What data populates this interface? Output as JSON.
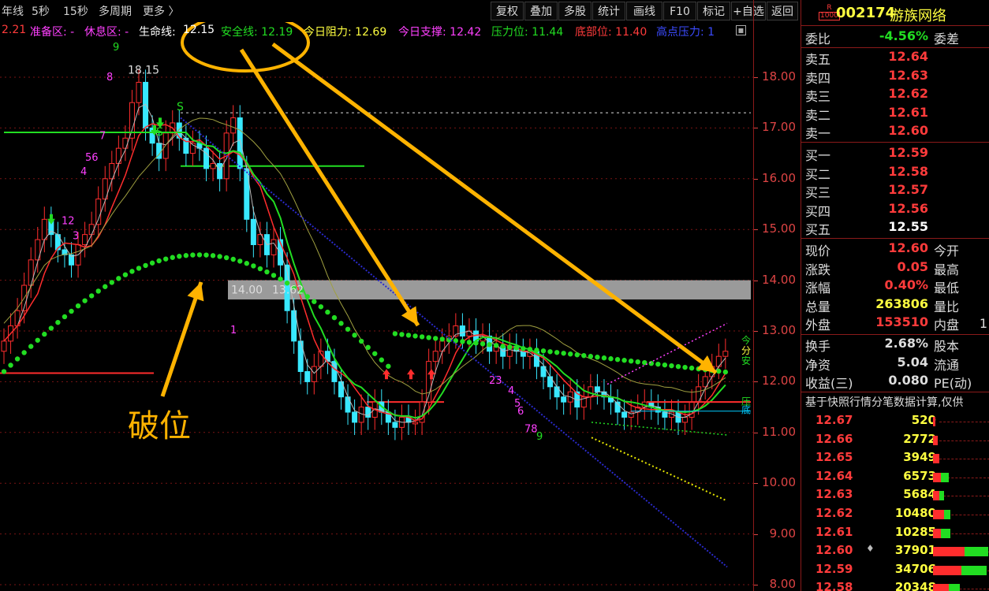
{
  "toolbar": {
    "periods": [
      "年线",
      "5秒",
      "15秒",
      "多周期",
      "更多 〉"
    ],
    "buttons": [
      "复权",
      "叠加",
      "多股",
      "统计",
      "画线",
      "F10",
      "标记",
      "+自选",
      "返回"
    ]
  },
  "indicators": {
    "first_value": "2.21",
    "zhunbei": "准备区: -",
    "xiuxi": "休息区: -",
    "shengming_label": "生命线:",
    "shengming_value": "12.15",
    "anquan": "安全线: 12.19",
    "zuli": "今日阻力: 12.69",
    "zhicheng": "今日支撑: 12.42",
    "yali": "压力位: 11.44",
    "dibu": "底部位: 11.40",
    "gaodian": "高点压力: 1"
  },
  "chart": {
    "price_ticks": [
      "18.00",
      "17.00",
      "16.00",
      "15.00",
      "14.00",
      "13.00",
      "12.00",
      "11.00",
      "10.00",
      "9.00",
      "8.00"
    ],
    "labels": {
      "high": "18.15",
      "mid1": "14.00",
      "mid2": "13.62",
      "seq": [
        "9",
        "8",
        "7",
        "56",
        "4",
        "12",
        "3",
        "1",
        "23",
        "4",
        "5",
        "6",
        "78",
        "9"
      ],
      "s1": "S",
      "s2": "S",
      "right_tags": [
        "今",
        "分",
        "安",
        "压",
        "底"
      ]
    },
    "annotation": "破位",
    "colors": {
      "up": "#ff2d2d",
      "down": "#38e8ff",
      "ma_green": "#22dd22",
      "annot": "#ffb300"
    }
  },
  "panel": {
    "code_prefix": "R\n1000",
    "stock_code": "002174",
    "stock_name": "游族网络",
    "weibi_label": "委比",
    "weibi_value": "-4.56%",
    "weicha_label": "委差",
    "sell": [
      {
        "label": "卖五",
        "price": "12.64"
      },
      {
        "label": "卖四",
        "price": "12.63"
      },
      {
        "label": "卖三",
        "price": "12.62"
      },
      {
        "label": "卖二",
        "price": "12.61"
      },
      {
        "label": "卖一",
        "price": "12.60"
      }
    ],
    "buy": [
      {
        "label": "买一",
        "price": "12.59"
      },
      {
        "label": "买二",
        "price": "12.58"
      },
      {
        "label": "买三",
        "price": "12.57"
      },
      {
        "label": "买四",
        "price": "12.56"
      },
      {
        "label": "买五",
        "price": "12.55"
      }
    ],
    "stats": [
      {
        "label": "现价",
        "value": "12.60",
        "label2": "今开",
        "color": "#ff3b3b"
      },
      {
        "label": "涨跌",
        "value": "0.05",
        "label2": "最高",
        "color": "#ff3b3b"
      },
      {
        "label": "涨幅",
        "value": "0.40%",
        "label2": "最低",
        "color": "#ff3b3b"
      },
      {
        "label": "总量",
        "value": "263806",
        "label2": "量比",
        "color": "#ffff40"
      },
      {
        "label": "外盘",
        "value": "153510",
        "label2": "内盘",
        "color": "#ff3b3b"
      }
    ],
    "stats_tail": "1",
    "stats2": [
      {
        "label": "换手",
        "value": "2.68%",
        "label2": "股本",
        "color": "#ddd"
      },
      {
        "label": "净资",
        "value": "5.04",
        "label2": "流通",
        "color": "#ddd"
      },
      {
        "label": "收益(三)",
        "value": "0.080",
        "label2": "PE(动)",
        "color": "#ddd"
      }
    ],
    "snapshot_note": "基于快照行情分笔数据计算,仅供",
    "ticks": [
      {
        "price": "12.67",
        "vol": "520",
        "r": 3,
        "g": 0
      },
      {
        "price": "12.66",
        "vol": "2772",
        "r": 6,
        "g": 0
      },
      {
        "price": "12.65",
        "vol": "3949",
        "r": 8,
        "g": 0
      },
      {
        "price": "12.64",
        "vol": "6573",
        "r": 10,
        "g": 10
      },
      {
        "price": "12.63",
        "vol": "5684",
        "r": 8,
        "g": 6
      },
      {
        "price": "12.62",
        "vol": "10480",
        "r": 14,
        "g": 8
      },
      {
        "price": "12.61",
        "vol": "10285",
        "r": 10,
        "g": 12
      },
      {
        "price": "12.60",
        "vol": "37901",
        "r": 40,
        "g": 30,
        "marker": "♦"
      },
      {
        "price": "12.59",
        "vol": "34706",
        "r": 36,
        "g": 32
      },
      {
        "price": "12.58",
        "vol": "20348",
        "r": 20,
        "g": 14
      }
    ]
  }
}
